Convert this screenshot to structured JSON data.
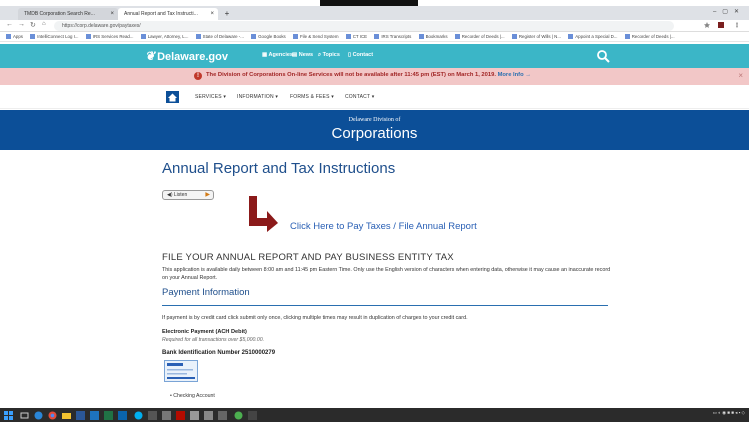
{
  "browser": {
    "tabs": [
      {
        "label": "TMDB Corporation Search Re..."
      },
      {
        "label": "Annual Report and Tax Instructi..."
      }
    ],
    "url": "https://corp.delaware.gov/paytaxes/",
    "bookmarks": [
      "Apps",
      "IntelliConnect Log I...",
      "IRS Services Read...",
      "Lawyer, Attorney, L...",
      "State of Delaware -...",
      "Google Books",
      "File & Send System",
      "CT ICE",
      "IRS Transcripts",
      "Bookmarks",
      "Recorder of Deeds |...",
      "Register of Wills | N...",
      "Appoint a Special D...",
      "Recorder of Deeds |..."
    ]
  },
  "site_nav": {
    "logo": "Delaware.gov",
    "links": [
      "Agencies",
      "News",
      "Topics",
      "Contact"
    ]
  },
  "alert": {
    "text": "The Division of Corporations On-line Services will not be available after 11:45 pm (EST) on March 1, 2019.",
    "more": "More Info →"
  },
  "subnav": [
    "SERVICES",
    "INFORMATION",
    "FORMS & FEES",
    "CONTACT"
  ],
  "banner": {
    "small": "Delaware Division of",
    "big": "Corporations"
  },
  "page": {
    "title": "Annual Report and Tax Instructions",
    "listen": "Listen",
    "pay_link": "Click Here to Pay Taxes / File Annual Report",
    "heading": "FILE YOUR ANNUAL REPORT AND PAY BUSINESS ENTITY TAX",
    "para": "This application is available daily between 8:00 am and 11:45 pm Eastern Time. Only use the English version of characters when entering data, otherwise it may cause an inaccurate record on your Annual Report.",
    "section": "Payment Information",
    "note": "If payment is by credit card click submit only once, clicking multiple times may result in duplication of charges to your credit card.",
    "ach": "Electronic Payment (ACH Debit)",
    "required": "Required for all transactions over $5,000.00.",
    "bank": "Bank Identification Number 2510000279",
    "bullet": "Checking Account"
  },
  "colors": {
    "nav": "#3bb6c7",
    "banner": "#0c4f98",
    "alert_bg": "#f2c7c7",
    "arrow": "#8b1a1a",
    "link": "#2a60b5"
  }
}
